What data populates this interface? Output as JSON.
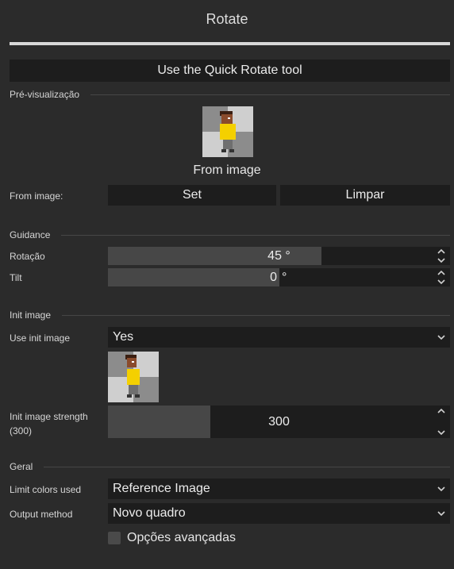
{
  "dialog": {
    "title": "Rotate"
  },
  "quick_rotate": {
    "label": "Use the Quick Rotate tool"
  },
  "preview": {
    "section": "Pré-visualização",
    "caption": "From image"
  },
  "from_image": {
    "label": "From image:",
    "set_label": "Set",
    "clear_label": "Limpar"
  },
  "guidance": {
    "section": "Guidance",
    "rotation": {
      "label": "Rotação",
      "value": "45 °",
      "fraction": 0.625
    },
    "tilt": {
      "label": "Tilt",
      "value": "0",
      "unit": "°",
      "fraction": 0.5
    }
  },
  "init_image": {
    "section": "Init image",
    "use_label": "Use init image",
    "use_value": "Yes",
    "strength_label": "Init image strength (300)",
    "strength_value": "300",
    "strength_fraction": 0.3
  },
  "general": {
    "section": "Geral",
    "limit_colors_label": "Limit colors used",
    "limit_colors_value": "Reference Image",
    "output_method_label": "Output method",
    "output_method_value": "Novo quadro",
    "advanced_label": "Opções avançadas"
  },
  "icons": {
    "dropdown": "chevron-down-icon",
    "spin_up": "chevron-up-icon",
    "spin_down": "chevron-down-icon"
  },
  "colors": {
    "background": "#2b2b2b",
    "field": "#1d1d1d",
    "slider_fill": "#474747",
    "character_shirt": "#f4d000",
    "character_skin": "#8a4b2c"
  }
}
